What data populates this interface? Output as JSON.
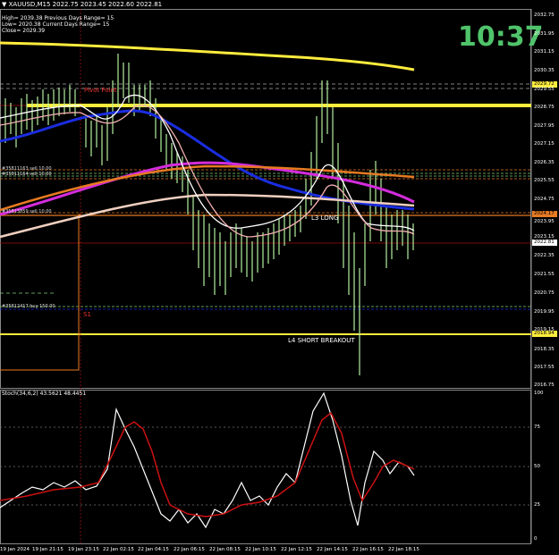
{
  "header": {
    "symbol_title": "▼ XAUUSD,M15  2022.75 2023.45 2022.60 2022.81",
    "info_line1": "High= 2039.38    Previous Days Range= 15",
    "info_line2": "Low= 2020.38     Current Days Range= 15",
    "info_line3": "Close= 2029.39"
  },
  "clock": "10:37",
  "labels": {
    "pivot": "Pivot Point",
    "s1": "S1",
    "l3": "L3 LONG",
    "l4": "L4 SHORT BREAKOUT"
  },
  "order_labels": [
    "#35811163 sell 10.00",
    "#35811164 sell 10.00",
    "#35813859 sell 10.00",
    "#35812417 buy 150.00"
  ],
  "indicator_title": "Stoch(34,6,2) 43.5621 48.4451",
  "price_scale": [
    "2032.75",
    "2031.95",
    "2031.15",
    "2030.35",
    "2029.55",
    "2028.75",
    "2027.95",
    "2027.15",
    "2026.35",
    "2025.55",
    "2024.75",
    "2023.95",
    "2023.15",
    "2022.35",
    "2021.55",
    "2020.75",
    "2019.95",
    "2019.15",
    "2018.35",
    "2017.55",
    "2016.75"
  ],
  "price_tags": {
    "tag1": "2029.72",
    "tag2": "2024.17",
    "tag3": "2022.81",
    "tag4": "2018.94"
  },
  "stoch_scale": [
    "100",
    "75",
    "50",
    "25",
    "0"
  ],
  "time_scale": [
    "19 Jan 2024",
    "19 Jan 21:15",
    "19 Jan 23:15",
    "22 Jan 02:15",
    "22 Jan 04:15",
    "22 Jan 06:15",
    "22 Jan 08:15",
    "22 Jan 10:15",
    "22 Jan 12:15",
    "22 Jan 14:15",
    "22 Jan 16:15",
    "22 Jan 18:15"
  ],
  "colors": {
    "yellow": "#ffec3d",
    "blue": "#1a2de0",
    "magenta": "#d42cdc",
    "orange": "#e77a22",
    "pale": "#f0d0c0",
    "green": "#b4f0a0",
    "red": "#cc1111",
    "clock": "#4fc46b"
  }
}
